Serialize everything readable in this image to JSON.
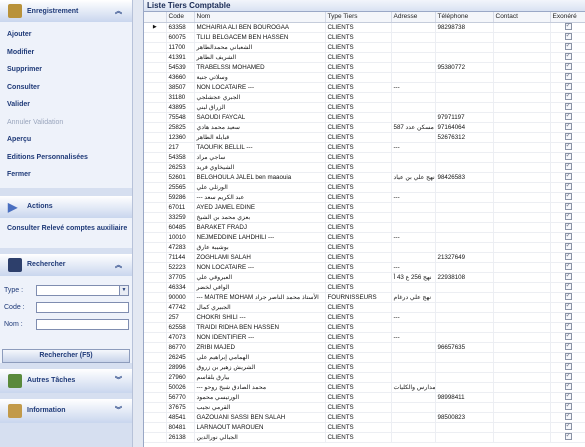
{
  "sidebar": {
    "enregistrement": {
      "title": "Enregistrement"
    },
    "actions_menu": [
      "Ajouter",
      "Modifier",
      "Supprimer",
      "Consulter",
      "Valider",
      "Annuler Validation",
      "Aperçu",
      "Editions Personnalisées",
      "Fermer"
    ],
    "actions": {
      "title": "Actions",
      "item": "Consulter Relevé comptes auxiliaire"
    },
    "rechercher": {
      "title": "Rechercher",
      "type_label": "Type :",
      "code_label": "Code :",
      "nom_label": "Nom :",
      "button": "Rechercher (F5)"
    },
    "autres": {
      "title": "Autres Tâches"
    },
    "information": {
      "title": "Information"
    }
  },
  "main": {
    "title": "Liste Tiers Comptable",
    "columns": [
      "Code",
      "Nom",
      "Type Tiers",
      "Adresse",
      "Téléphone",
      "Contact",
      "Exonéré"
    ],
    "rows": [
      [
        "63358",
        "MCHAIRIA ALI BEN BOUROGAA",
        "CLIENTS",
        "",
        "98298738",
        "",
        "✓"
      ],
      [
        "60075",
        "TLILI BELGACEM BEN HASSEN",
        "CLIENTS",
        "",
        "",
        "",
        "✓"
      ],
      [
        "11700",
        "الشعباني محمدالطاهر",
        "CLIENTS",
        "",
        "",
        "",
        "✓"
      ],
      [
        "41391",
        "الشريف الطاهر",
        "CLIENTS",
        "",
        "",
        "",
        "✓"
      ],
      [
        "54539",
        "TRABELSSI MOHAMED",
        "CLIENTS",
        "",
        "95380772",
        "",
        "✓"
      ],
      [
        "43660",
        "وسلاتي جنية",
        "CLIENTS",
        "",
        "",
        "",
        "✓"
      ],
      [
        "38507",
        "NON LOCATAIRE ---",
        "CLIENTS",
        "---",
        "",
        "",
        "✓"
      ],
      [
        "31180",
        "الجبري عجشلجي",
        "CLIENTS",
        "",
        "",
        "",
        "✓"
      ],
      [
        "43895",
        "الزراق لبني",
        "CLIENTS",
        "",
        "",
        "",
        "✓"
      ],
      [
        "75548",
        "SAOUDI FAYCAL",
        "CLIENTS",
        "",
        "97971197",
        "",
        "✓"
      ],
      [
        "25825",
        "سعيد محمد هادي",
        "CLIENTS",
        "مسكن عدد 587",
        "97164064",
        "",
        "✓"
      ],
      [
        "12360",
        "قبايلة الطاهر",
        "CLIENTS",
        "",
        "52676312",
        "",
        "✓"
      ],
      [
        "217",
        "TAOUFIK BELLIL ---",
        "CLIENTS",
        "---",
        "",
        "",
        "✓"
      ],
      [
        "54358",
        "ساجي مراد",
        "CLIENTS",
        "",
        "",
        "",
        "✓"
      ],
      [
        "26253",
        "الشيخاوي فريد",
        "CLIENTS",
        "",
        "",
        "",
        "✓"
      ],
      [
        "52601",
        "BELGHOULA JALEL ben maaouia",
        "CLIENTS",
        "نهج علي بن عياد",
        "98426583",
        "",
        "✓"
      ],
      [
        "25565",
        "الورثلي علي",
        "CLIENTS",
        "",
        "",
        "",
        "✓"
      ],
      [
        "59286",
        "--- عبد الكريم سعد",
        "CLIENTS",
        "---",
        "",
        "",
        "✓"
      ],
      [
        "67011",
        "AYED JAMEL EDINE",
        "CLIENTS",
        "",
        "",
        "",
        "✓"
      ],
      [
        "33259",
        "بعزي محمد بن الشيخ",
        "CLIENTS",
        "",
        "",
        "",
        "✓"
      ],
      [
        "60485",
        "BARAKET FRADJ",
        "CLIENTS",
        "",
        "",
        "",
        "✓"
      ],
      [
        "10010",
        "NEJMEDDINE LAHDHILI ---",
        "CLIENTS",
        "---",
        "",
        "",
        "✓"
      ],
      [
        "47283",
        "بوشيبة عارق",
        "CLIENTS",
        "",
        "",
        "",
        "✓"
      ],
      [
        "71144",
        "ZOGHLAMI SALAH",
        "CLIENTS",
        "",
        "21327649",
        "",
        "✓"
      ],
      [
        "52223",
        "NON LOCATAIRE ---",
        "CLIENTS",
        "---",
        "",
        "",
        "✓"
      ],
      [
        "37705",
        "العبروقي علي",
        "CLIENTS",
        "نهج 256 ع 43 أ",
        "22938108",
        "",
        "✓"
      ],
      [
        "46334",
        "الوافي لخضر",
        "CLIENTS",
        "",
        "",
        "",
        "✓"
      ],
      [
        "90000",
        "--- MAITRE MOHAM الأستاذ محمد الناصر جراد",
        "FOURNISSEURS",
        "نهج علي درغام",
        "",
        "",
        "✓"
      ],
      [
        "47742",
        "الجبيري كمال",
        "CLIENTS",
        "",
        "",
        "",
        "✓"
      ],
      [
        "257",
        "CHOKRI SHILI ---",
        "CLIENTS",
        "---",
        "",
        "",
        "✓"
      ],
      [
        "62558",
        "TRAIDI RIDHA BEN HASSEN",
        "CLIENTS",
        "",
        "",
        "",
        "✓"
      ],
      [
        "47073",
        "NON IDENTIFIER ---",
        "CLIENTS",
        "---",
        "",
        "",
        "✓"
      ],
      [
        "86770",
        "ZRIBI MAJED",
        "CLIENTS",
        "",
        "96657635",
        "",
        "✓"
      ],
      [
        "26245",
        "الهمامي إبراهيم علي",
        "CLIENTS",
        "",
        "",
        "",
        "✓"
      ],
      [
        "28996",
        "الشريش زهير بن زروق",
        "CLIENTS",
        "",
        "",
        "",
        "✓"
      ],
      [
        "27960",
        "بيارق بلقاسم",
        "CLIENTS",
        "",
        "",
        "",
        "✓"
      ],
      [
        "50026",
        "--- محمد الصادق شيخ روحو",
        "CLIENTS",
        "ل. المدارس والكليات",
        "",
        "",
        "✓"
      ],
      [
        "56770",
        "الورتيسي محمود",
        "CLIENTS",
        "",
        "98998411",
        "",
        "✓"
      ],
      [
        "37675",
        "القرمي نجيب",
        "CLIENTS",
        "",
        "",
        "",
        "✓"
      ],
      [
        "48541",
        "GAZOUANI SASSI BEN SALAH",
        "CLIENTS",
        "",
        "98500823",
        "",
        "✓"
      ],
      [
        "80481",
        "LARNAOUT MAROUEN",
        "CLIENTS",
        "",
        "",
        "",
        "✓"
      ],
      [
        "26138",
        "الجبالي نورالدين",
        "CLIENTS",
        "",
        "",
        "",
        "✓"
      ]
    ]
  }
}
